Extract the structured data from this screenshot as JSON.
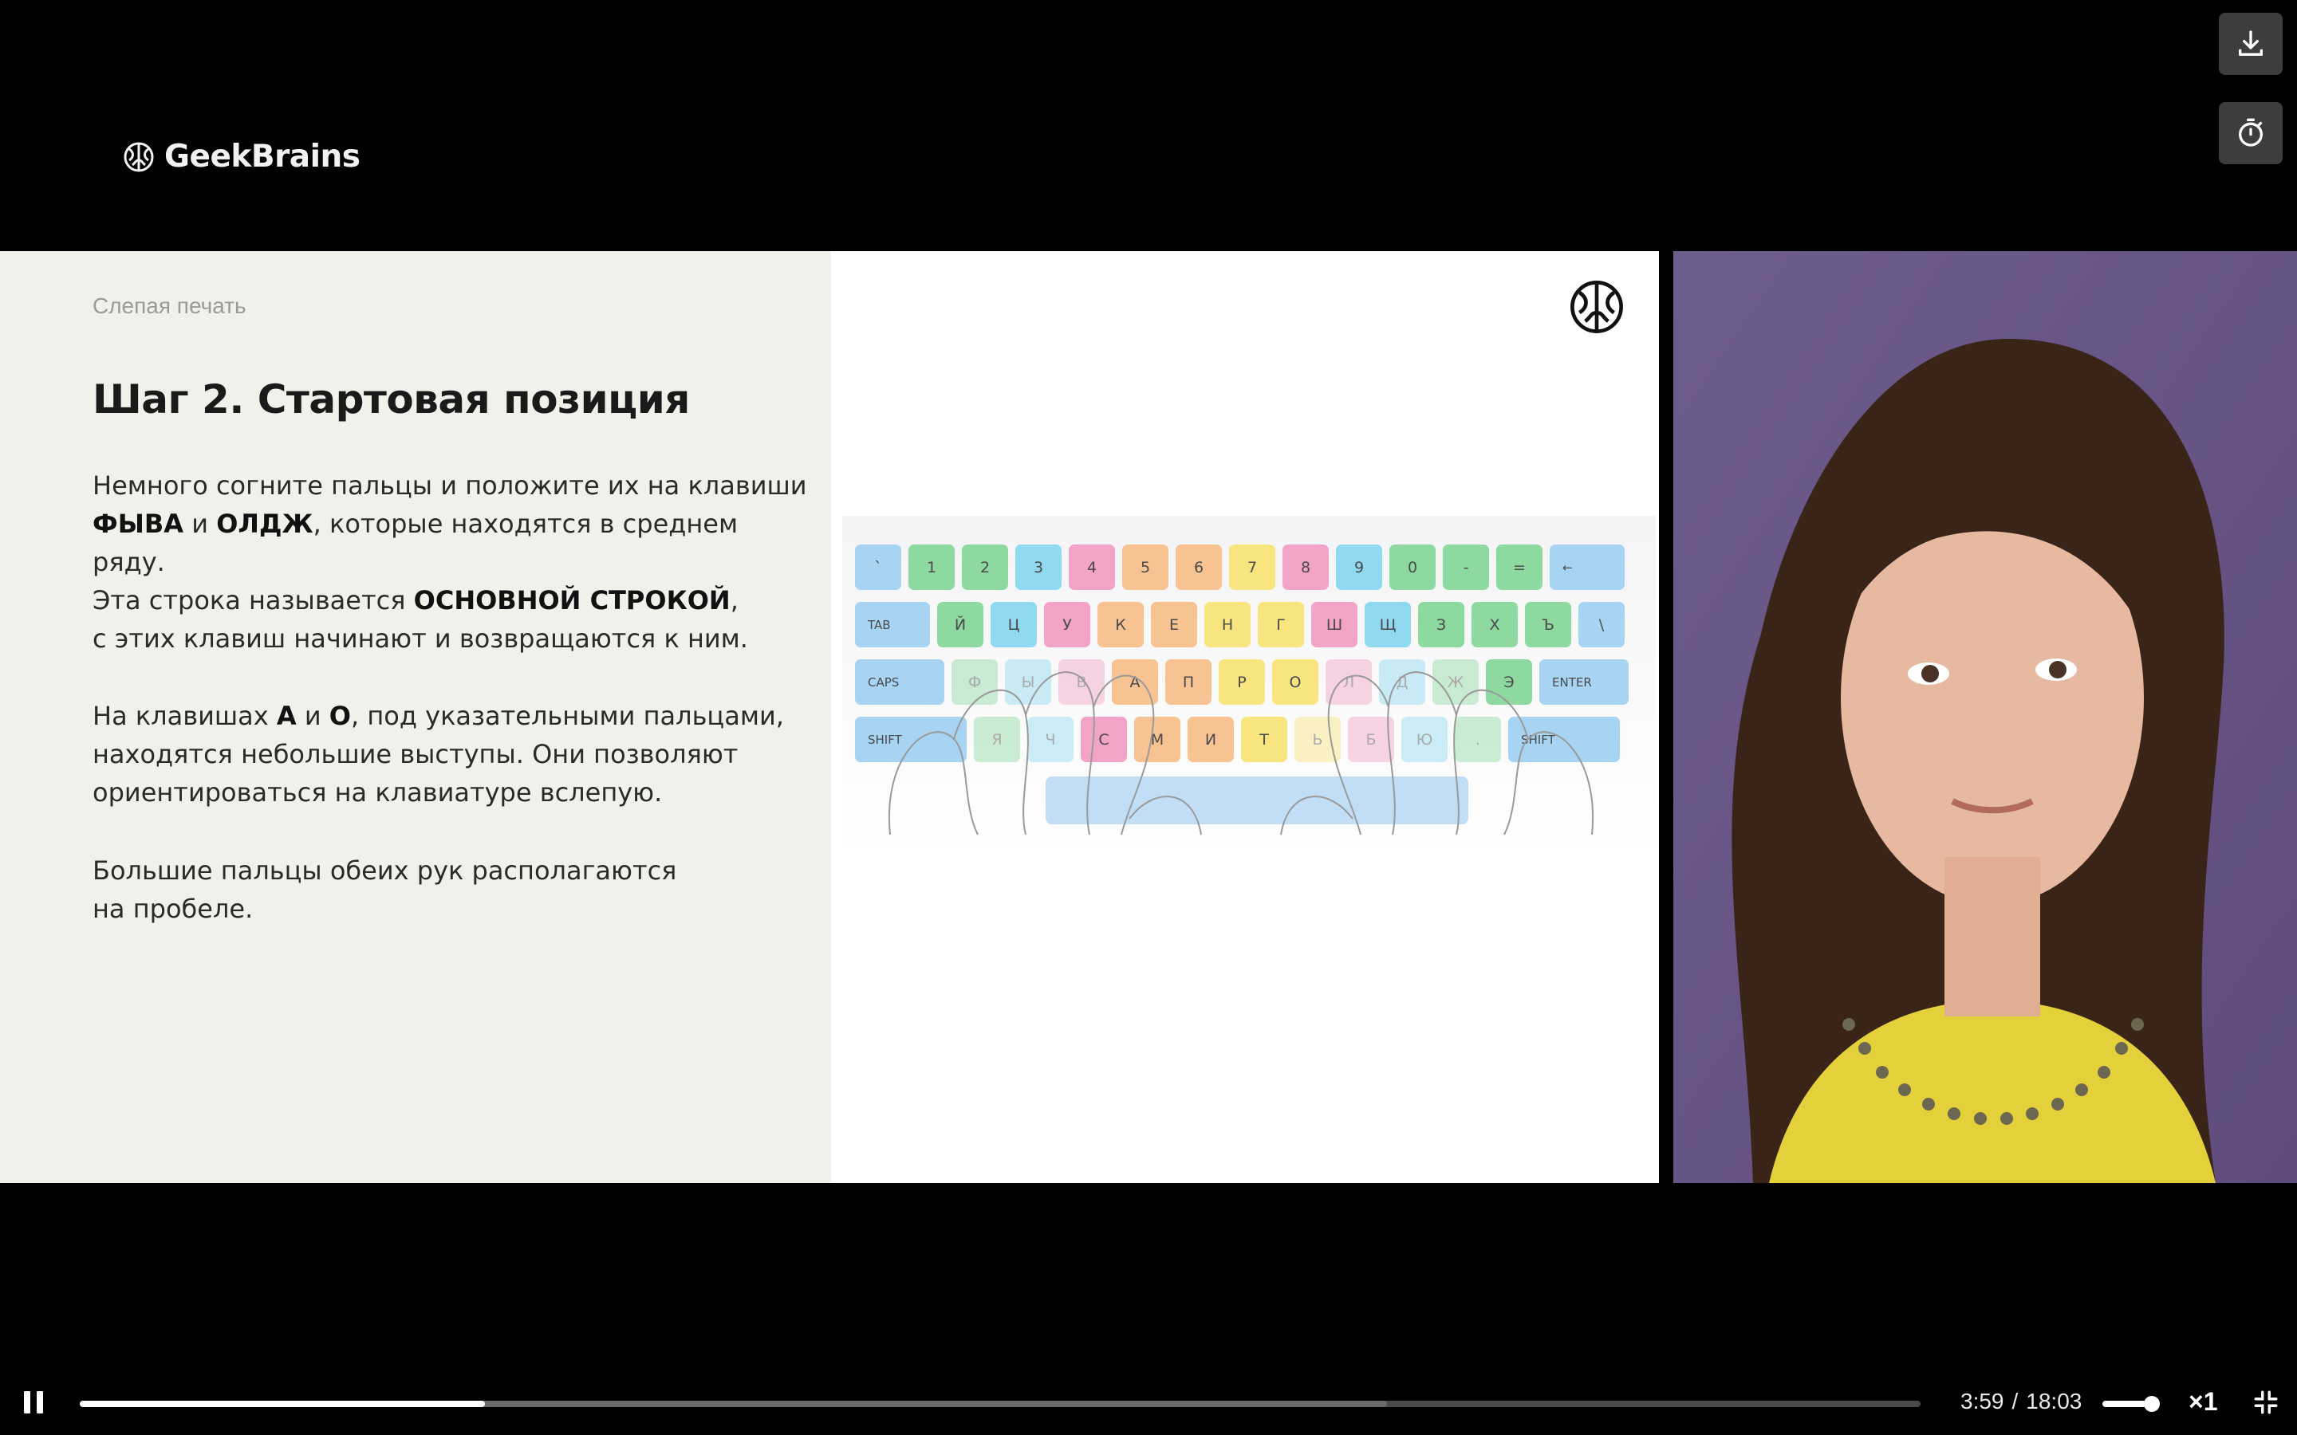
{
  "brand": {
    "name": "GeekBrains"
  },
  "top_buttons": {
    "download_icon": "download-icon",
    "timer_icon": "timer-icon"
  },
  "slide": {
    "eyebrow": "Слепая печать",
    "title": "Шаг 2. Стартовая позиция",
    "p1_a": "Немного согните пальцы и положите их на клавиши",
    "p1_b1": "ФЫВА",
    "p1_c": " и ",
    "p1_b2": "ОЛДЖ",
    "p1_d": ", которые находятся в среднем ряду.",
    "p2_a": "Эта строка называется ",
    "p2_b": "ОСНОВНОЙ СТРОКОЙ",
    "p2_c": ",",
    "p2_d": "с этих клавиш начинают и возвращаются к ним.",
    "p3_a": "На клавишах ",
    "p3_b1": "А",
    "p3_c": " и ",
    "p3_b2": "О",
    "p3_d": ", под указательными пальцами,",
    "p3_e": "находятся небольшие выступы. Они позволяют",
    "p3_f": "ориентироваться на клавиатуре вслепую.",
    "p4_a": "Большие пальцы обеих рук располагаются",
    "p4_b": "на пробеле."
  },
  "keyboard": {
    "row1": [
      {
        "l": "`",
        "c": "k-blue"
      },
      {
        "l": "1",
        "c": "k-green"
      },
      {
        "l": "2",
        "c": "k-green"
      },
      {
        "l": "3",
        "c": "k-cyan"
      },
      {
        "l": "4",
        "c": "k-pink"
      },
      {
        "l": "5",
        "c": "k-orange"
      },
      {
        "l": "6",
        "c": "k-orange"
      },
      {
        "l": "7",
        "c": "k-yellow"
      },
      {
        "l": "8",
        "c": "k-pink"
      },
      {
        "l": "9",
        "c": "k-cyan"
      },
      {
        "l": "0",
        "c": "k-green"
      },
      {
        "l": "-",
        "c": "k-green"
      },
      {
        "l": "=",
        "c": "k-green"
      },
      {
        "l": "←",
        "c": "k-blue",
        "w": "wide"
      }
    ],
    "row2": [
      {
        "l": "TAB",
        "c": "k-blue",
        "w": "wide"
      },
      {
        "l": "Й",
        "c": "k-green"
      },
      {
        "l": "Ц",
        "c": "k-cyan"
      },
      {
        "l": "У",
        "c": "k-pink"
      },
      {
        "l": "К",
        "c": "k-orange"
      },
      {
        "l": "Е",
        "c": "k-orange"
      },
      {
        "l": "Н",
        "c": "k-yellow"
      },
      {
        "l": "Г",
        "c": "k-yellow"
      },
      {
        "l": "Ш",
        "c": "k-pink"
      },
      {
        "l": "Щ",
        "c": "k-cyan"
      },
      {
        "l": "З",
        "c": "k-green"
      },
      {
        "l": "Х",
        "c": "k-green"
      },
      {
        "l": "Ъ",
        "c": "k-green"
      },
      {
        "l": "\\",
        "c": "k-blue"
      }
    ],
    "row3": [
      {
        "l": "CAPS",
        "c": "k-blue",
        "w": "xwide"
      },
      {
        "l": "Ф",
        "c": "k-green k-faded"
      },
      {
        "l": "Ы",
        "c": "k-cyan k-faded"
      },
      {
        "l": "В",
        "c": "k-pink k-faded"
      },
      {
        "l": "А",
        "c": "k-orange"
      },
      {
        "l": "П",
        "c": "k-orange"
      },
      {
        "l": "Р",
        "c": "k-yellow"
      },
      {
        "l": "О",
        "c": "k-yellow"
      },
      {
        "l": "Л",
        "c": "k-pink k-faded"
      },
      {
        "l": "Д",
        "c": "k-cyan k-faded"
      },
      {
        "l": "Ж",
        "c": "k-green k-faded"
      },
      {
        "l": "Э",
        "c": "k-green"
      },
      {
        "l": "ENTER",
        "c": "k-blue",
        "w": "xwide"
      }
    ],
    "row4": [
      {
        "l": "SHIFT",
        "c": "k-blue",
        "w": "xwide2"
      },
      {
        "l": "Я",
        "c": "k-green k-faded"
      },
      {
        "l": "Ч",
        "c": "k-cyan k-faded"
      },
      {
        "l": "С",
        "c": "k-pink"
      },
      {
        "l": "М",
        "c": "k-orange"
      },
      {
        "l": "И",
        "c": "k-orange"
      },
      {
        "l": "Т",
        "c": "k-yellow"
      },
      {
        "l": "Ь",
        "c": "k-yellow k-faded"
      },
      {
        "l": "Б",
        "c": "k-pink k-faded"
      },
      {
        "l": "Ю",
        "c": "k-cyan k-faded"
      },
      {
        "l": ".",
        "c": "k-green k-faded"
      },
      {
        "l": "SHIFT",
        "c": "k-blue",
        "w": "xwide2"
      }
    ]
  },
  "player": {
    "progress": 0.22,
    "buffered": 0.71,
    "current_time": "3:59",
    "separator": "/",
    "duration": "18:03",
    "volume": 1.0,
    "speed": "×1",
    "pause_icon": "pause-icon",
    "exit_fullscreen_icon": "exit-fullscreen-icon"
  }
}
